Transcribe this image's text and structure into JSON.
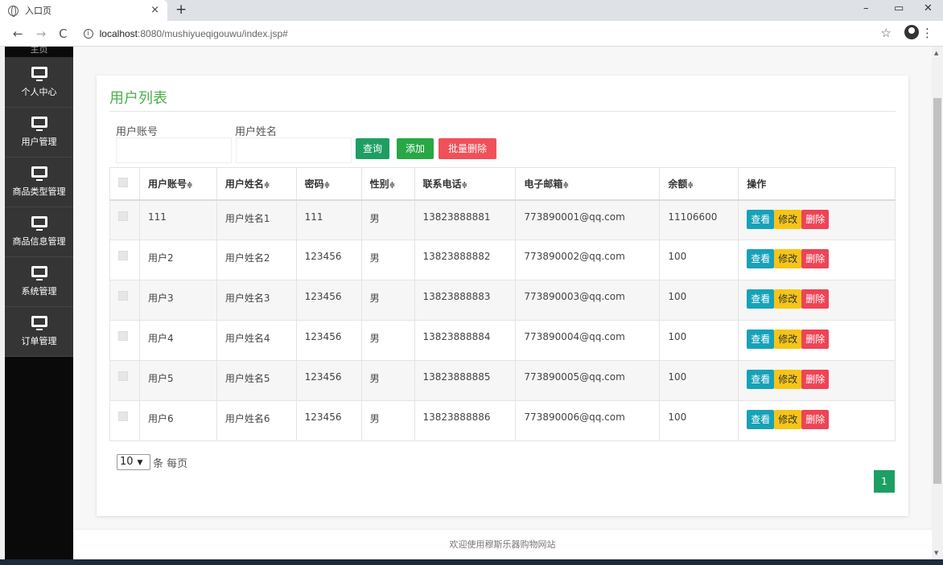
{
  "browser": {
    "tab_title": "入口页",
    "tab_close": "×",
    "new_tab": "+",
    "url_host": "localhost",
    "url_path": ":8080/mushiyueqigouwu/index.jsp#",
    "win_min": "–",
    "win_restore": "▭",
    "win_close": "✕"
  },
  "sidebar": {
    "top_partial": "主页",
    "items": [
      {
        "label": "个人中心",
        "icon": "monitor-icon"
      },
      {
        "label": "用户管理",
        "icon": "monitor-icon"
      },
      {
        "label": "商品类型管理",
        "icon": "monitor-icon"
      },
      {
        "label": "商品信息管理",
        "icon": "monitor-icon"
      },
      {
        "label": "系统管理",
        "icon": "monitor-icon"
      },
      {
        "label": "订单管理",
        "icon": "monitor-icon"
      }
    ]
  },
  "page": {
    "title": "用户列表",
    "filters": {
      "account_label": "用户账号",
      "name_label": "用户姓名",
      "account_value": "",
      "name_value": ""
    },
    "buttons": {
      "search": "查询",
      "add": "添加",
      "batch_delete": "批量删除"
    },
    "table": {
      "headers": [
        "用户账号",
        "用户姓名",
        "密码",
        "性别",
        "联系电话",
        "电子邮箱",
        "余额",
        "操作"
      ],
      "sort_glyph": "≑",
      "rows": [
        {
          "account": "111",
          "name": "用户姓名1",
          "password": "111",
          "gender": "男",
          "phone": "13823888881",
          "email": "773890001@qq.com",
          "balance": "11106600"
        },
        {
          "account": "用户2",
          "name": "用户姓名2",
          "password": "123456",
          "gender": "男",
          "phone": "13823888882",
          "email": "773890002@qq.com",
          "balance": "100"
        },
        {
          "account": "用户3",
          "name": "用户姓名3",
          "password": "123456",
          "gender": "男",
          "phone": "13823888883",
          "email": "773890003@qq.com",
          "balance": "100"
        },
        {
          "account": "用户4",
          "name": "用户姓名4",
          "password": "123456",
          "gender": "男",
          "phone": "13823888884",
          "email": "773890004@qq.com",
          "balance": "100"
        },
        {
          "account": "用户5",
          "name": "用户姓名5",
          "password": "123456",
          "gender": "男",
          "phone": "13823888885",
          "email": "773890005@qq.com",
          "balance": "100"
        },
        {
          "account": "用户6",
          "name": "用户姓名6",
          "password": "123456",
          "gender": "男",
          "phone": "13823888886",
          "email": "773890006@qq.com",
          "balance": "100"
        }
      ],
      "row_actions": {
        "view": "查看",
        "edit": "修改",
        "delete": "删除"
      }
    },
    "pagination": {
      "per_page_value": "10",
      "per_page_suffix": "条 每页",
      "current_page": "1"
    }
  },
  "footer": {
    "text": "欢迎使用穆斯乐器购物网站"
  },
  "colors": {
    "accent_green": "#1e9e63",
    "title_green": "#4cae4c",
    "view_blue": "#17a2b8",
    "edit_yellow": "#f5c518",
    "delete_red": "#ee4455"
  }
}
